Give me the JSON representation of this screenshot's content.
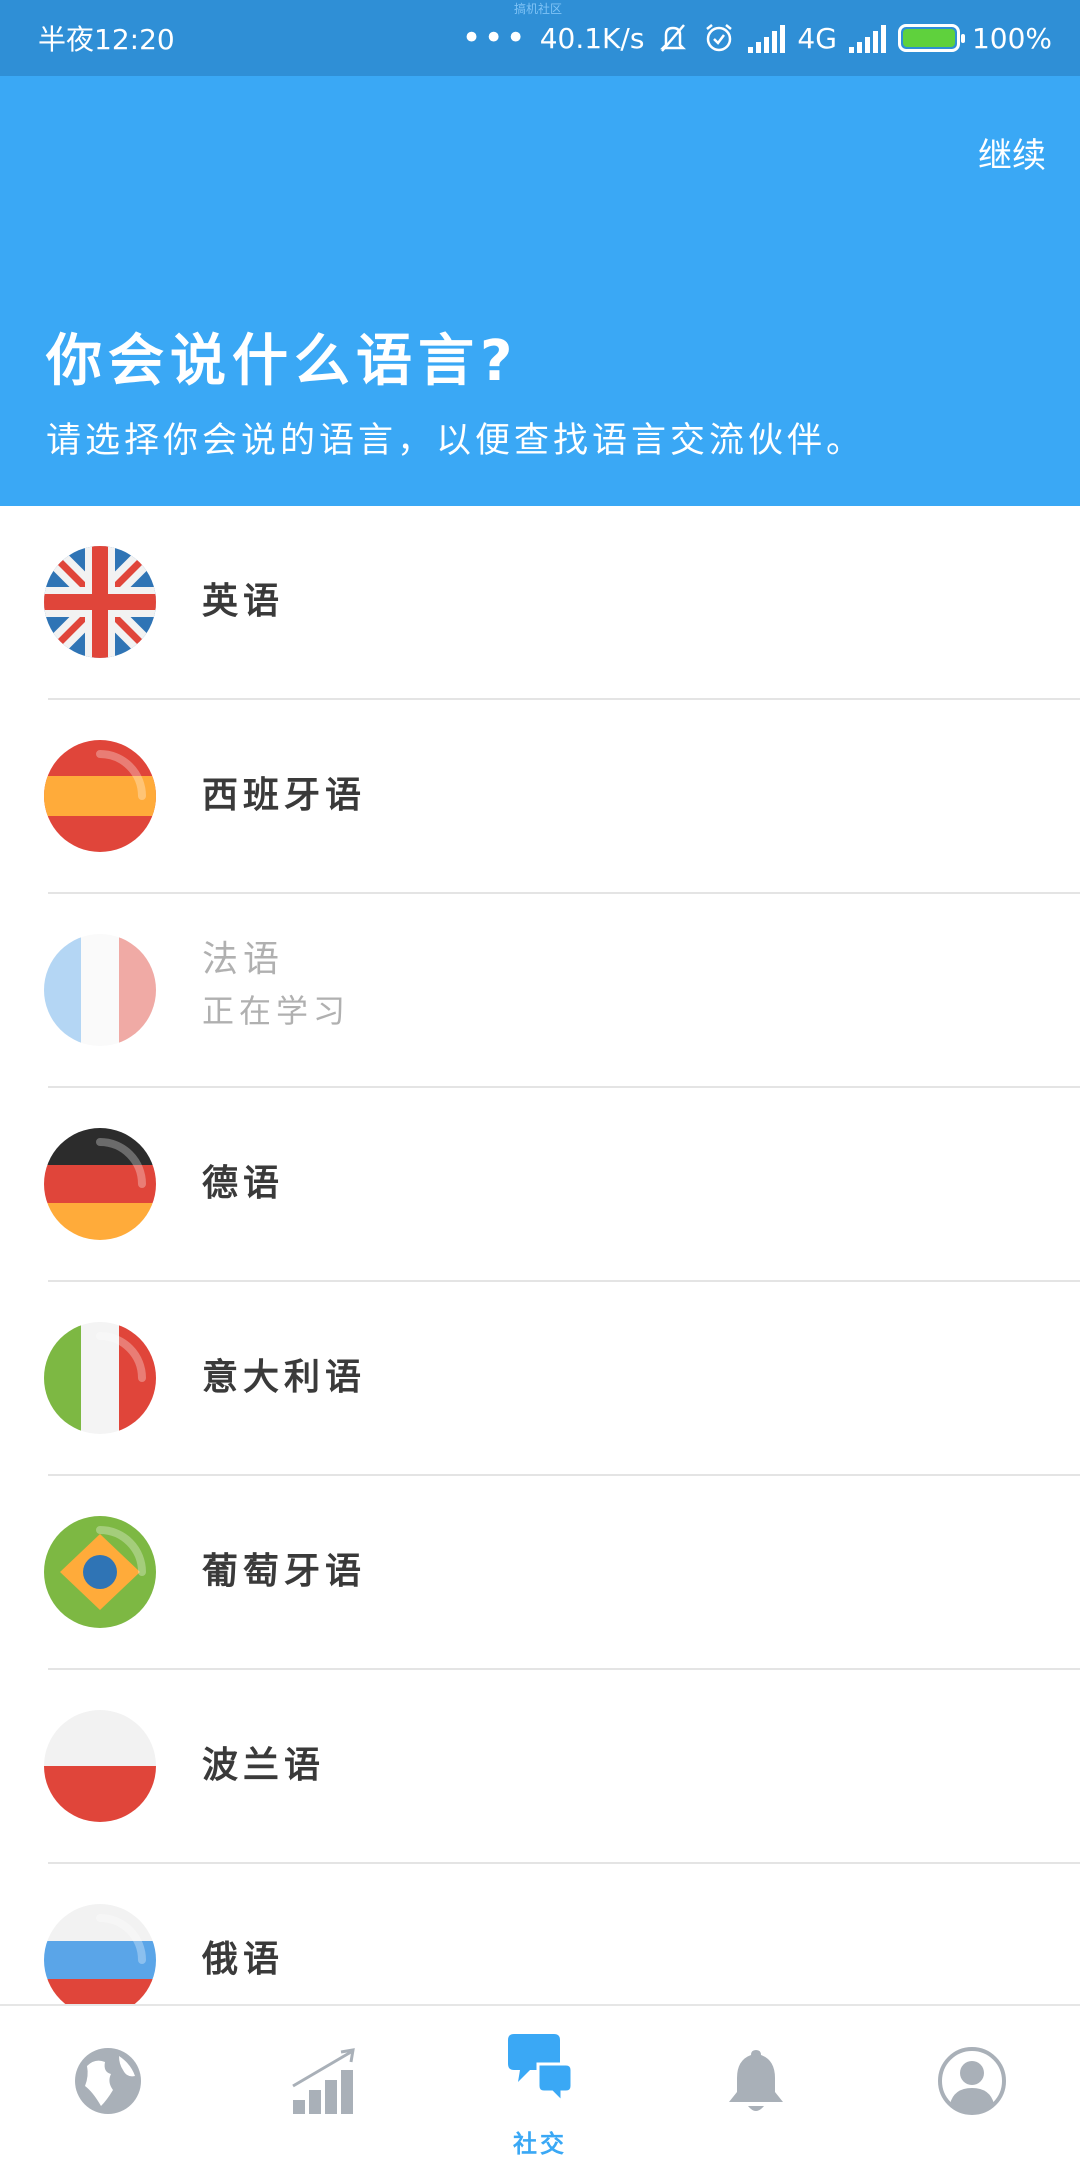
{
  "status_bar": {
    "time": "半夜12:20",
    "tiny_label": "搞机社区",
    "ellipsis": "•••",
    "net_speed": "40.1K/s",
    "network": "4G",
    "battery": "100%"
  },
  "header": {
    "continue_label": "继续",
    "title": "你会说什么语言?",
    "subtitle": "请选择你会说的语言，以便查找语言交流伙伴。"
  },
  "languages": [
    {
      "name": "英语",
      "flag": "uk-flag-icon"
    },
    {
      "name": "西班牙语",
      "flag": "spain-flag-icon"
    },
    {
      "name": "法语",
      "status": "正在学习",
      "flag": "france-flag-icon"
    },
    {
      "name": "德语",
      "flag": "germany-flag-icon"
    },
    {
      "name": "意大利语",
      "flag": "italy-flag-icon"
    },
    {
      "name": "葡萄牙语",
      "flag": "brazil-flag-icon"
    },
    {
      "name": "波兰语",
      "flag": "poland-flag-icon"
    },
    {
      "name": "俄语",
      "flag": "russia-flag-icon"
    }
  ],
  "bottom_nav": {
    "active_label": "社交"
  },
  "colors": {
    "status_bar": "#2f8fd6",
    "header": "#3aa8f5",
    "accent": "#3aa8f5",
    "nav_inactive": "#a9b0b8"
  }
}
